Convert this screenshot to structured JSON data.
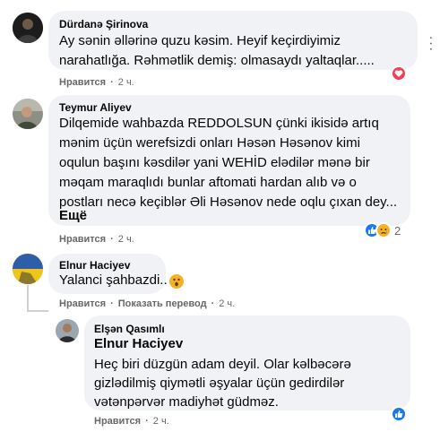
{
  "comments": [
    {
      "author": "Dürdanə Şirinova",
      "lines": [
        "Ay sənin əllərinə quzu kəsim. Heyif keçirdiyimiz",
        "narahatlığa. Rəhmətlik demiş: olmasaydı yaltaqlar....."
      ],
      "actions": {
        "like": "Нравится",
        "time": "2 ч."
      },
      "reaction": {
        "type": "love",
        "color": "#f33e58"
      }
    },
    {
      "author": "Teymur Aliyev",
      "lines": [
        "Dilqemide wahbazda REDDOLSUN çünki ikisidə artıq",
        "mənim üçün werefsizdi onları Həsən Həsənov kimi",
        "oqulun başını kəsdilər yani WEHİD elədilər mənə bir",
        "məqam maraqlıdı bunlar aftomati hardan alıb və o",
        "postları necə keçiblər Əli Həsənov nede oqlu çıxan dey..."
      ],
      "see_more": "Ещё",
      "actions": {
        "like": "Нравится",
        "time": "2 ч."
      },
      "reaction": {
        "types": [
          "like",
          "sad"
        ],
        "count": "2",
        "like_color": "#1877f2"
      }
    },
    {
      "author": "Elnur Haciyev",
      "lines": [
        "Yalanci şahbazdi..."
      ],
      "actions": {
        "like": "Нравится",
        "translate": "Показать перевод",
        "time": "2 ч."
      },
      "reaction": {
        "type": "wow"
      }
    },
    {
      "author": "Elşən Qasımlı",
      "mention": "Elnur Haciyev",
      "lines": [
        "Heç biri düzgün adam deyil. Olar kəlbəcərə",
        "gizlədilmiş qiymətli əşyalar üçün gedirdilər",
        "vətənpərvər madiyhət güdməz."
      ],
      "actions": {
        "like": "Нравится",
        "time": "2 ч."
      },
      "reaction": {
        "type": "like",
        "like_color": "#1877f2"
      }
    }
  ],
  "colors": {
    "bubble": "#f0f2f5",
    "meta": "#65676b",
    "text": "#050505"
  }
}
